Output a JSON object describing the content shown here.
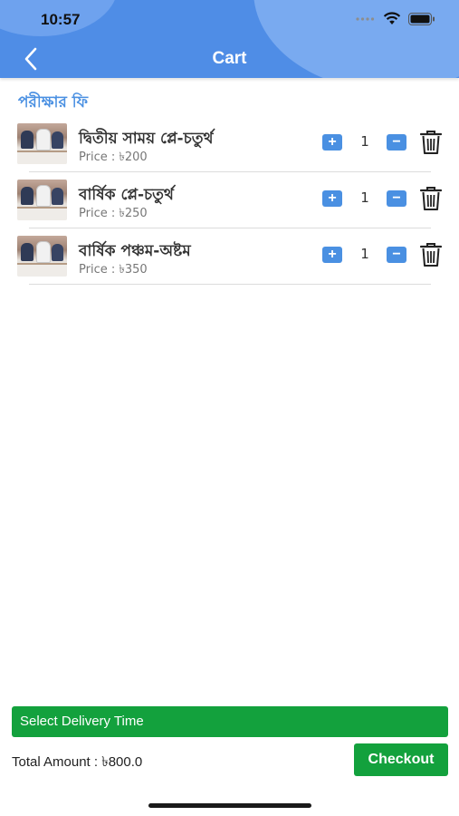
{
  "status_bar": {
    "time": "10:57"
  },
  "header": {
    "title": "Cart",
    "back_icon": "chevron-left-icon"
  },
  "section": {
    "title": "পরীক্ষার ফি"
  },
  "items": [
    {
      "name": "দ্বিতীয় সাময় প্লে-চতুর্থ",
      "price": "Price : ৳200",
      "qty": "1",
      "plus": "+",
      "minus": "−"
    },
    {
      "name": "বার্ষিক প্লে-চতুর্থ",
      "price": "Price : ৳250",
      "qty": "1",
      "plus": "+",
      "minus": "−"
    },
    {
      "name": "বার্ষিক পঞ্চম-অষ্টম",
      "price": "Price : ৳350",
      "qty": "1",
      "plus": "+",
      "minus": "−"
    }
  ],
  "footer": {
    "delivery_label": "Select Delivery Time",
    "total": "Total Amount : ৳800.0",
    "checkout_label": "Checkout"
  },
  "colors": {
    "header": "#4f8de6",
    "accent_blue": "#4a90e2",
    "accent_green": "#13a13d"
  }
}
